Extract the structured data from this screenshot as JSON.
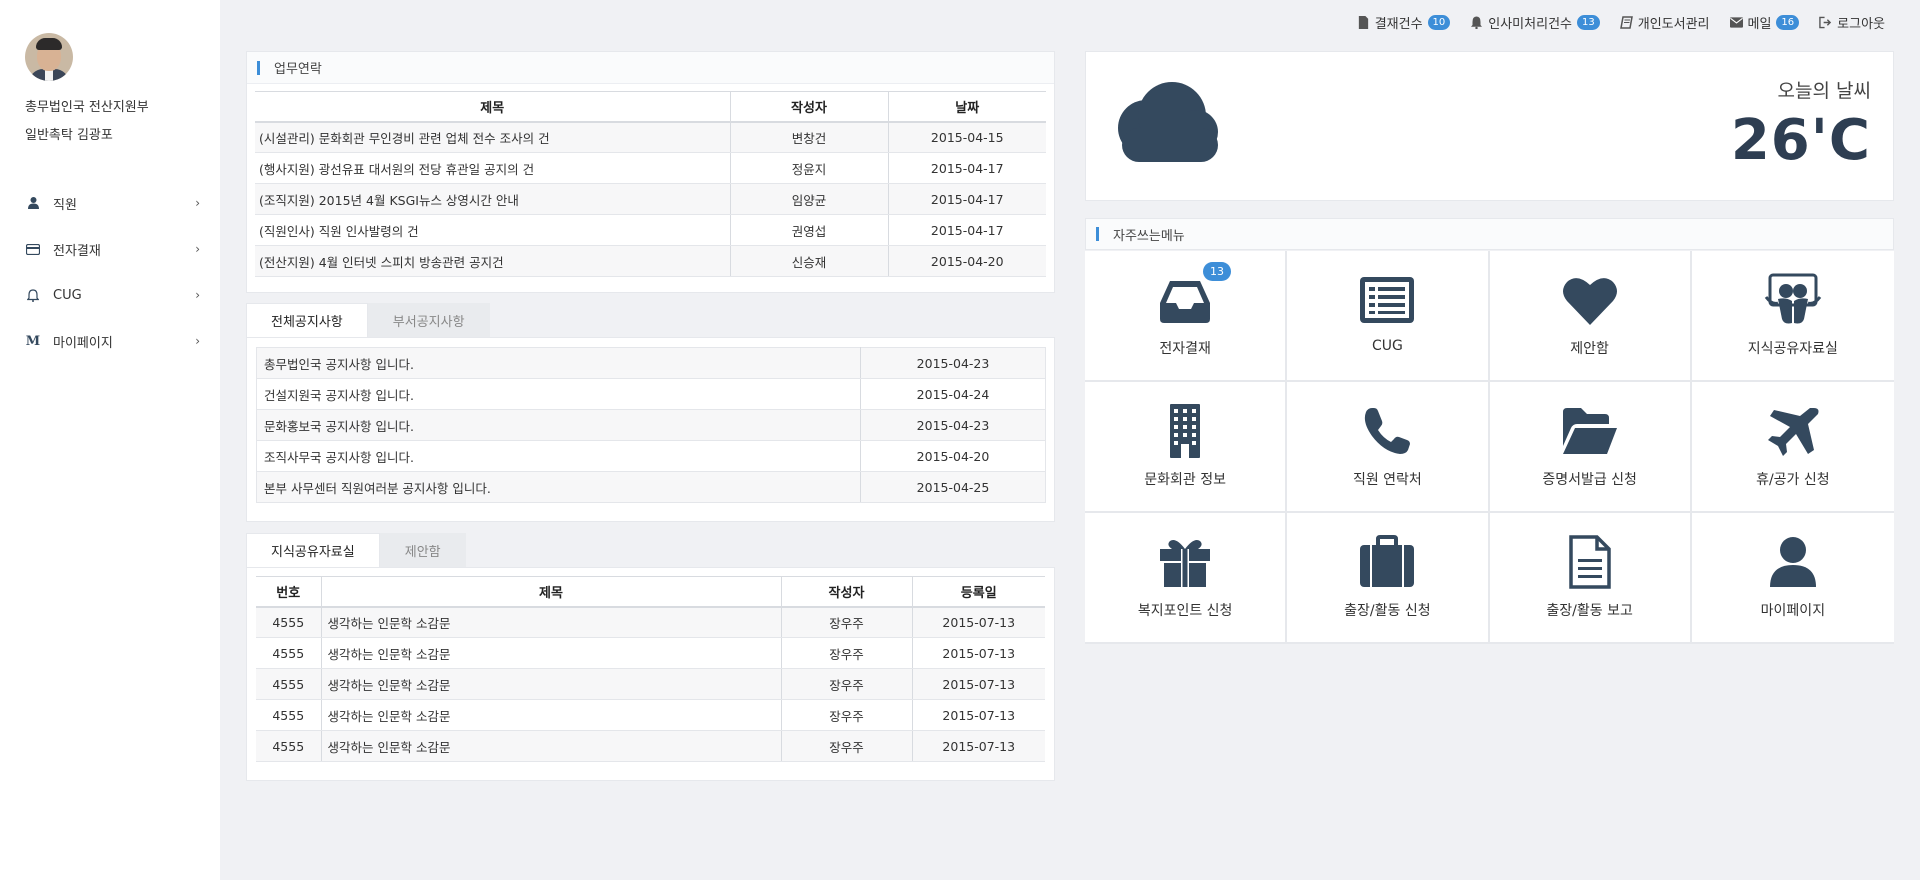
{
  "user": {
    "dept": "총무법인국 전산지원부",
    "name": "일반촉탁 김광포"
  },
  "nav": [
    {
      "label": "직원",
      "icon": "user-icon"
    },
    {
      "label": "전자결재",
      "icon": "credit-card-icon"
    },
    {
      "label": "CUG",
      "icon": "bell-icon"
    },
    {
      "label": "마이페이지",
      "icon": "m-icon"
    }
  ],
  "topbar": {
    "approval": {
      "label": "결재건수",
      "count": "10"
    },
    "hr": {
      "label": "인사미처리건수",
      "count": "13"
    },
    "library": {
      "label": "개인도서관리"
    },
    "mail": {
      "label": "메일",
      "count": "16"
    },
    "logout": {
      "label": "로그아웃"
    }
  },
  "work": {
    "title": "업무연락",
    "headers": [
      "제목",
      "작성자",
      "날짜"
    ],
    "rows": [
      [
        "(시설관리) 문화회관 무인경비 관련 업체 전수 조사의 건",
        "변창건",
        "2015-04-15"
      ],
      [
        "(행사지원) 광선유표 대서원의 전당 휴관일 공지의 건",
        "정윤지",
        "2015-04-17"
      ],
      [
        "(조직지원) 2015년 4월 KSGI뉴스 상영시간 안내",
        "임양균",
        "2015-04-17"
      ],
      [
        "(직원인사) 직원 인사발령의 건",
        "권영섭",
        "2015-04-17"
      ],
      [
        "(전산지원) 4월 인터넷 스피치 방송관련 공지건",
        "신승재",
        "2015-04-20"
      ]
    ]
  },
  "notice": {
    "tabs": [
      "전체공지사항",
      "부서공지사항"
    ],
    "rows": [
      [
        "총무법인국 공지사항 입니다.",
        "2015-04-23"
      ],
      [
        "건설지원국 공지사항 입니다.",
        "2015-04-24"
      ],
      [
        "문화홍보국 공지사항 입니다.",
        "2015-04-23"
      ],
      [
        "조직사무국 공지사항 입니다.",
        "2015-04-20"
      ],
      [
        "본부 사무센터 직원여러분 공지사항 입니다.",
        "2015-04-25"
      ]
    ]
  },
  "knowledge": {
    "tabs": [
      "지식공유자료실",
      "제안함"
    ],
    "headers": [
      "번호",
      "제목",
      "작성자",
      "등록일"
    ],
    "rows": [
      [
        "4555",
        "생각하는 인문학 소감문",
        "장우주",
        "2015-07-13"
      ],
      [
        "4555",
        "생각하는 인문학 소감문",
        "장우주",
        "2015-07-13"
      ],
      [
        "4555",
        "생각하는 인문학 소감문",
        "장우주",
        "2015-07-13"
      ],
      [
        "4555",
        "생각하는 인문학 소감문",
        "장우주",
        "2015-07-13"
      ],
      [
        "4555",
        "생각하는 인문학 소감문",
        "장우주",
        "2015-07-13"
      ]
    ]
  },
  "weather": {
    "label": "오늘의 날씨",
    "temp": "26'C",
    "icon": "cloud-icon"
  },
  "quickmenu": {
    "title": "자주쓰는메뉴",
    "items": [
      {
        "label": "전자결재",
        "icon": "inbox-icon",
        "badge": "13"
      },
      {
        "label": "CUG",
        "icon": "list-icon"
      },
      {
        "label": "제안함",
        "icon": "heart-icon"
      },
      {
        "label": "지식공유자료실",
        "icon": "slideshare-icon"
      },
      {
        "label": "문화회관 정보",
        "icon": "building-icon"
      },
      {
        "label": "직원 연락처",
        "icon": "phone-icon"
      },
      {
        "label": "증명서발급 신청",
        "icon": "folder-open-icon"
      },
      {
        "label": "휴/공가 신청",
        "icon": "plane-icon"
      },
      {
        "label": "복지포인트 신청",
        "icon": "gift-icon"
      },
      {
        "label": "출장/활동 신청",
        "icon": "briefcase-icon"
      },
      {
        "label": "출장/활동 보고",
        "icon": "document-icon"
      },
      {
        "label": "마이페이지",
        "icon": "user-icon"
      }
    ]
  },
  "colors": {
    "accent": "#3d8ed8",
    "icon": "#34495e",
    "background": "#f0f1f4"
  }
}
